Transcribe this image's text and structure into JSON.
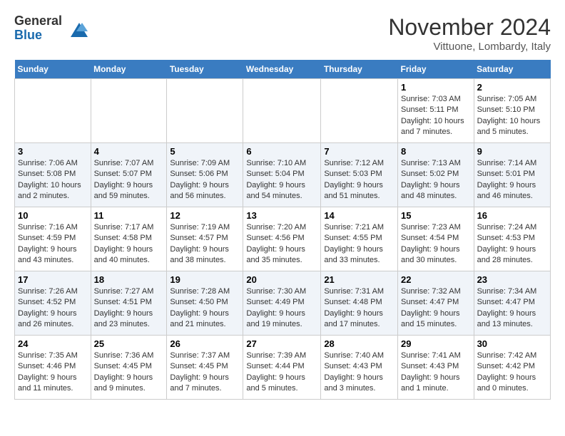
{
  "logo": {
    "general": "General",
    "blue": "Blue"
  },
  "title": "November 2024",
  "location": "Vittuone, Lombardy, Italy",
  "weekdays": [
    "Sunday",
    "Monday",
    "Tuesday",
    "Wednesday",
    "Thursday",
    "Friday",
    "Saturday"
  ],
  "weeks": [
    [
      {
        "day": "",
        "info": ""
      },
      {
        "day": "",
        "info": ""
      },
      {
        "day": "",
        "info": ""
      },
      {
        "day": "",
        "info": ""
      },
      {
        "day": "",
        "info": ""
      },
      {
        "day": "1",
        "info": "Sunrise: 7:03 AM\nSunset: 5:11 PM\nDaylight: 10 hours and 7 minutes."
      },
      {
        "day": "2",
        "info": "Sunrise: 7:05 AM\nSunset: 5:10 PM\nDaylight: 10 hours and 5 minutes."
      }
    ],
    [
      {
        "day": "3",
        "info": "Sunrise: 7:06 AM\nSunset: 5:08 PM\nDaylight: 10 hours and 2 minutes."
      },
      {
        "day": "4",
        "info": "Sunrise: 7:07 AM\nSunset: 5:07 PM\nDaylight: 9 hours and 59 minutes."
      },
      {
        "day": "5",
        "info": "Sunrise: 7:09 AM\nSunset: 5:06 PM\nDaylight: 9 hours and 56 minutes."
      },
      {
        "day": "6",
        "info": "Sunrise: 7:10 AM\nSunset: 5:04 PM\nDaylight: 9 hours and 54 minutes."
      },
      {
        "day": "7",
        "info": "Sunrise: 7:12 AM\nSunset: 5:03 PM\nDaylight: 9 hours and 51 minutes."
      },
      {
        "day": "8",
        "info": "Sunrise: 7:13 AM\nSunset: 5:02 PM\nDaylight: 9 hours and 48 minutes."
      },
      {
        "day": "9",
        "info": "Sunrise: 7:14 AM\nSunset: 5:01 PM\nDaylight: 9 hours and 46 minutes."
      }
    ],
    [
      {
        "day": "10",
        "info": "Sunrise: 7:16 AM\nSunset: 4:59 PM\nDaylight: 9 hours and 43 minutes."
      },
      {
        "day": "11",
        "info": "Sunrise: 7:17 AM\nSunset: 4:58 PM\nDaylight: 9 hours and 40 minutes."
      },
      {
        "day": "12",
        "info": "Sunrise: 7:19 AM\nSunset: 4:57 PM\nDaylight: 9 hours and 38 minutes."
      },
      {
        "day": "13",
        "info": "Sunrise: 7:20 AM\nSunset: 4:56 PM\nDaylight: 9 hours and 35 minutes."
      },
      {
        "day": "14",
        "info": "Sunrise: 7:21 AM\nSunset: 4:55 PM\nDaylight: 9 hours and 33 minutes."
      },
      {
        "day": "15",
        "info": "Sunrise: 7:23 AM\nSunset: 4:54 PM\nDaylight: 9 hours and 30 minutes."
      },
      {
        "day": "16",
        "info": "Sunrise: 7:24 AM\nSunset: 4:53 PM\nDaylight: 9 hours and 28 minutes."
      }
    ],
    [
      {
        "day": "17",
        "info": "Sunrise: 7:26 AM\nSunset: 4:52 PM\nDaylight: 9 hours and 26 minutes."
      },
      {
        "day": "18",
        "info": "Sunrise: 7:27 AM\nSunset: 4:51 PM\nDaylight: 9 hours and 23 minutes."
      },
      {
        "day": "19",
        "info": "Sunrise: 7:28 AM\nSunset: 4:50 PM\nDaylight: 9 hours and 21 minutes."
      },
      {
        "day": "20",
        "info": "Sunrise: 7:30 AM\nSunset: 4:49 PM\nDaylight: 9 hours and 19 minutes."
      },
      {
        "day": "21",
        "info": "Sunrise: 7:31 AM\nSunset: 4:48 PM\nDaylight: 9 hours and 17 minutes."
      },
      {
        "day": "22",
        "info": "Sunrise: 7:32 AM\nSunset: 4:47 PM\nDaylight: 9 hours and 15 minutes."
      },
      {
        "day": "23",
        "info": "Sunrise: 7:34 AM\nSunset: 4:47 PM\nDaylight: 9 hours and 13 minutes."
      }
    ],
    [
      {
        "day": "24",
        "info": "Sunrise: 7:35 AM\nSunset: 4:46 PM\nDaylight: 9 hours and 11 minutes."
      },
      {
        "day": "25",
        "info": "Sunrise: 7:36 AM\nSunset: 4:45 PM\nDaylight: 9 hours and 9 minutes."
      },
      {
        "day": "26",
        "info": "Sunrise: 7:37 AM\nSunset: 4:45 PM\nDaylight: 9 hours and 7 minutes."
      },
      {
        "day": "27",
        "info": "Sunrise: 7:39 AM\nSunset: 4:44 PM\nDaylight: 9 hours and 5 minutes."
      },
      {
        "day": "28",
        "info": "Sunrise: 7:40 AM\nSunset: 4:43 PM\nDaylight: 9 hours and 3 minutes."
      },
      {
        "day": "29",
        "info": "Sunrise: 7:41 AM\nSunset: 4:43 PM\nDaylight: 9 hours and 1 minute."
      },
      {
        "day": "30",
        "info": "Sunrise: 7:42 AM\nSunset: 4:42 PM\nDaylight: 9 hours and 0 minutes."
      }
    ]
  ]
}
